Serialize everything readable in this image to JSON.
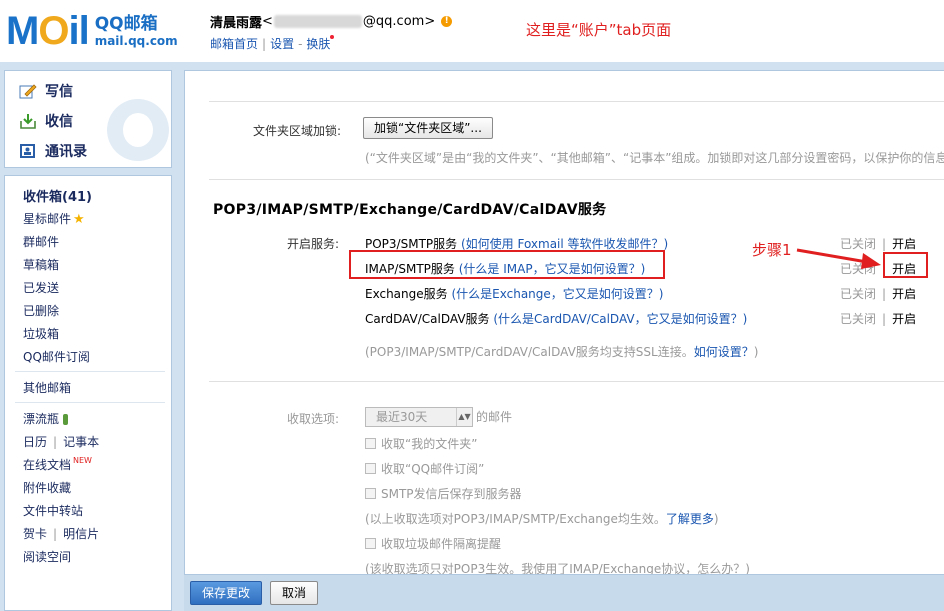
{
  "header": {
    "logo_text": "MOil",
    "logo_title": "QQ邮箱",
    "logo_subtitle": "mail.qq.com",
    "user_name": "清晨雨露",
    "email_prefix": "<",
    "email_suffix": "@qq.com>",
    "links": [
      "邮箱首页",
      "设置",
      "换肤"
    ],
    "annotation": "这里是“账户”tab页面"
  },
  "nav": {
    "compose": "写信",
    "inbox": "收信",
    "contacts": "通讯录",
    "folders": [
      {
        "label": "收件箱(41)",
        "bold": true
      },
      {
        "label": "星标邮件"
      },
      {
        "label": "群邮件"
      },
      {
        "label": "草稿箱"
      },
      {
        "label": "已发送"
      },
      {
        "label": "已删除"
      },
      {
        "label": "垃圾箱"
      },
      {
        "label": "QQ邮件订阅"
      }
    ],
    "other_mailbox": "其他邮箱",
    "apps": {
      "drift_bottle": "漂流瓶",
      "calendar": "日历",
      "notepad": "记事本",
      "online_docs": "在线文档",
      "new_badge": "NEW",
      "attachments": "附件收藏",
      "file_transfer": "文件中转站",
      "card": "贺卡",
      "postcard": "明信片",
      "reading": "阅读空间"
    }
  },
  "settings": {
    "folder_lock_label": "文件夹区域加锁:",
    "folder_lock_button": "加锁“文件夹区域”...",
    "folder_lock_desc": "(“文件夹区域”是由“我的文件夹”、“其他邮箱”、“记事本”组成。加锁即对这几部分设置密码，以保护你的信息",
    "section_title": "POP3/IMAP/SMTP/Exchange/CardDAV/CalDAV服务",
    "service_label": "开启服务:",
    "services": [
      {
        "name": "POP3/SMTP服务",
        "help": "(如何使用 Foxmail 等软件收发邮件？)",
        "closed": "已关闭",
        "open": "开启"
      },
      {
        "name": "IMAP/SMTP服务",
        "help": "(什么是 IMAP，它又是如何设置？)",
        "closed": "已关闭",
        "open": "开启"
      },
      {
        "name": "Exchange服务",
        "help": "(什么是Exchange，它又是如何设置？)",
        "closed": "已关闭",
        "open": "开启"
      },
      {
        "name": "CardDAV/CalDAV服务",
        "help": "(什么是CardDAV/CalDAV，它又是如何设置？)",
        "closed": "已关闭",
        "open": "开启"
      }
    ],
    "ssl_note_prefix": "(POP3/IMAP/SMTP/CardDAV/CalDAV服务均支持SSL连接。",
    "ssl_note_link": "如何设置？",
    "ssl_note_suffix": ")",
    "receive_label": "收取选项:",
    "receive_select": "最近30天",
    "receive_select_suffix": "的邮件",
    "checkbox_my_folders": "收取“我的文件夹”",
    "checkbox_subscription": "收取“QQ邮件订阅”",
    "checkbox_smtp_save": "SMTP发信后保存到服务器",
    "receive_note_prefix": "(以上收取选项对POP3/IMAP/SMTP/Exchange均生效。",
    "receive_note_link": "了解更多",
    "receive_note_suffix": ")",
    "checkbox_spam": "收取垃圾邮件隔离提醒",
    "pop3_note": "(该收取选项只对POP3生效。我使用了IMAP/Exchange协议，怎么办？)"
  },
  "footer": {
    "save": "保存更改",
    "cancel": "取消"
  },
  "annotations": {
    "step1": "步骤1",
    "color": "#e02020"
  }
}
